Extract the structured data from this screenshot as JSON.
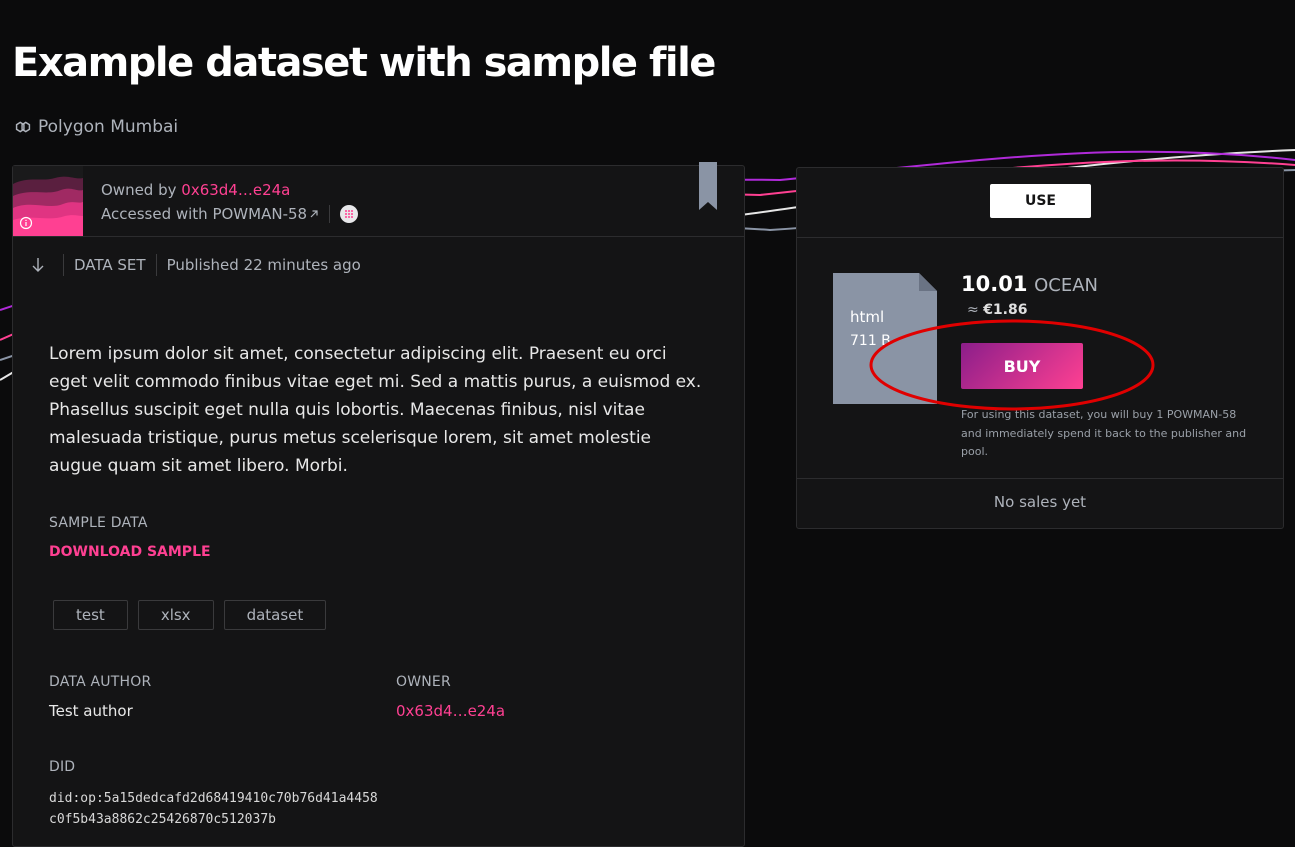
{
  "page": {
    "title": "Example dataset with sample file",
    "network": "Polygon Mumbai"
  },
  "asset": {
    "owned_by_prefix": "Owned by",
    "owner_short": "0x63d4…e24a",
    "accessed_with": "Accessed with POWMAN-58",
    "type": "DATA SET",
    "published": "Published 22 minutes ago",
    "description": "Lorem ipsum dolor sit amet, consectetur adipiscing elit. Praesent eu orci eget velit commodo finibus vitae eget mi. Sed a mattis purus, a euismod ex. Phasellus suscipit eget nulla quis lobortis. Maecenas finibus, nisl vitae malesuada tristique, purus metus scelerisque lorem, sit amet molestie augue quam sit amet libero. Morbi.",
    "sample_label": "SAMPLE DATA",
    "sample_link": "DOWNLOAD SAMPLE",
    "tags": [
      "test",
      "xlsx",
      "dataset"
    ],
    "author_label": "DATA AUTHOR",
    "author": "Test author",
    "owner_label": "OWNER",
    "owner": "0x63d4…e24a",
    "did_label": "DID",
    "did": "did:op:5a15dedcafd2d68419410c70b76d41a4458c0f5b43a8862c25426870c512037b"
  },
  "purchase": {
    "tab_use": "USE",
    "file_type": "html",
    "file_size": "711 B",
    "price_value": "10.01",
    "price_token": "OCEAN",
    "fiat_prefix": "≈",
    "fiat_value": "€1.86",
    "buy_label": "BUY",
    "note": "For using this dataset, you will buy 1 POWMAN-58 and immediately spend it back to the publisher and pool.",
    "sales": "No sales yet"
  },
  "icons": {
    "network": "polygon-link-icon",
    "arrow": "external-arrow-icon",
    "ocean": "ocean-logo-icon",
    "bookmark": "bookmark-icon",
    "download": "download-arrow-icon",
    "info": "info-icon",
    "file": "file-icon"
  },
  "colors": {
    "accent": "#ff4092",
    "buy_gradient_start": "#8b1e8a",
    "buy_gradient_end": "#ff4092",
    "annotation": "#e00000"
  }
}
